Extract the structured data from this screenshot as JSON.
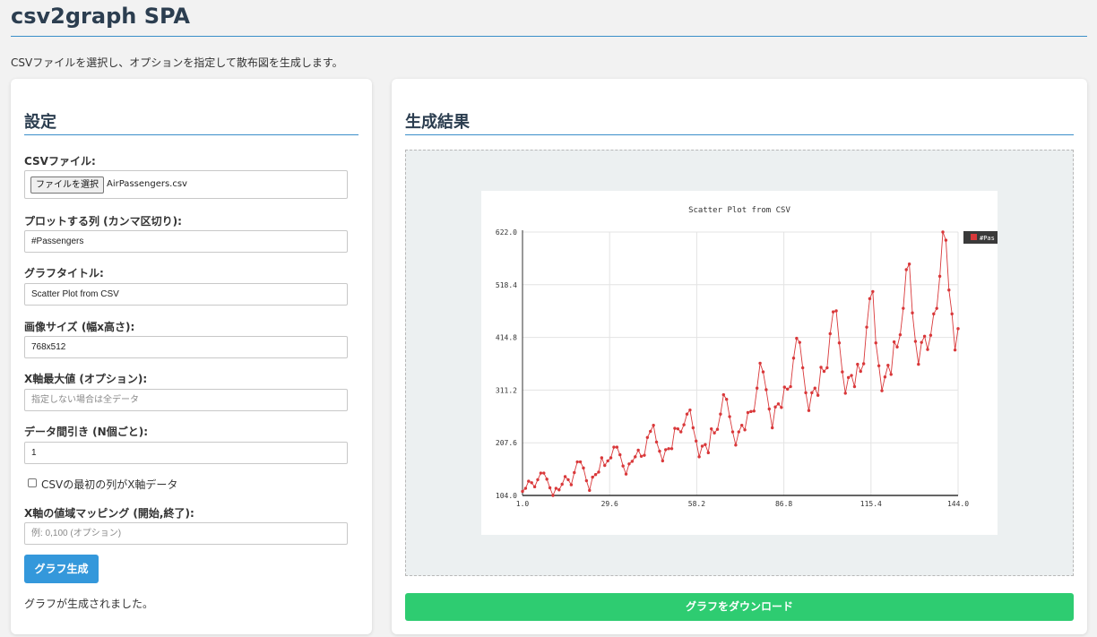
{
  "app": {
    "title": "csv2graph SPA",
    "intro": "CSVファイルを選択し、オプションを指定して散布図を生成します。"
  },
  "settings": {
    "heading": "設定",
    "csv_label": "CSVファイル:",
    "file_button_label": "ファイルを選択",
    "file_name": "AirPassengers.csv",
    "columns_label": "プロットする列 (カンマ区切り):",
    "columns_value": "#Passengers",
    "title_label": "グラフタイトル:",
    "title_value": "Scatter Plot from CSV",
    "size_label": "画像サイズ (幅x高さ):",
    "size_value": "768x512",
    "xmax_label": "X軸最大値 (オプション):",
    "xmax_placeholder": "指定しない場合は全データ",
    "thin_label": "データ間引き (N個ごと):",
    "thin_value": "1",
    "first_col_x_label": "CSVの最初の列がX軸データ",
    "first_col_x_checked": false,
    "xmap_label": "X軸の値域マッピング (開始,終了):",
    "xmap_placeholder": "例: 0,100 (オプション)",
    "generate_button": "グラフ生成",
    "status": "グラフが生成されました。"
  },
  "result": {
    "heading": "生成結果",
    "download_button": "グラフをダウンロード"
  },
  "colors": {
    "accent": "#3498db",
    "download": "#2ecc71",
    "heading": "#2c3e50",
    "series": "#d9383a"
  },
  "chart_data": {
    "type": "line",
    "title": "Scatter Plot from CSV",
    "xlim": [
      1.0,
      144.0
    ],
    "ylim": [
      104.0,
      622.0
    ],
    "x_ticks": [
      "1.0",
      "29.6",
      "58.2",
      "86.8",
      "115.4",
      "144.0"
    ],
    "y_ticks": [
      "104.0",
      "207.6",
      "311.2",
      "414.8",
      "518.4",
      "622.0"
    ],
    "grid": true,
    "legend_position": "top-right",
    "series": [
      {
        "name": "#Pas",
        "color": "#d9383a",
        "x_start": 1,
        "x_step": 1,
        "values": [
          112,
          118,
          132,
          129,
          121,
          135,
          148,
          148,
          136,
          119,
          104,
          118,
          115,
          126,
          141,
          135,
          125,
          149,
          170,
          170,
          158,
          133,
          114,
          140,
          145,
          150,
          178,
          163,
          172,
          178,
          199,
          199,
          184,
          162,
          146,
          166,
          171,
          180,
          193,
          181,
          183,
          218,
          230,
          242,
          209,
          191,
          172,
          194,
          196,
          196,
          236,
          235,
          229,
          243,
          264,
          272,
          237,
          211,
          180,
          201,
          204,
          188,
          235,
          227,
          234,
          264,
          302,
          293,
          259,
          229,
          203,
          229,
          242,
          233,
          267,
          269,
          270,
          315,
          364,
          347,
          312,
          274,
          237,
          278,
          284,
          277,
          317,
          313,
          318,
          374,
          413,
          405,
          355,
          306,
          271,
          306,
          315,
          301,
          356,
          348,
          355,
          422,
          465,
          467,
          404,
          347,
          305,
          336,
          340,
          318,
          362,
          348,
          363,
          435,
          491,
          505,
          404,
          359,
          310,
          337,
          360,
          342,
          406,
          396,
          420,
          472,
          548,
          559,
          463,
          407,
          362,
          405,
          417,
          391,
          419,
          461,
          472,
          535,
          622,
          606,
          508,
          461,
          390,
          432
        ]
      }
    ]
  }
}
